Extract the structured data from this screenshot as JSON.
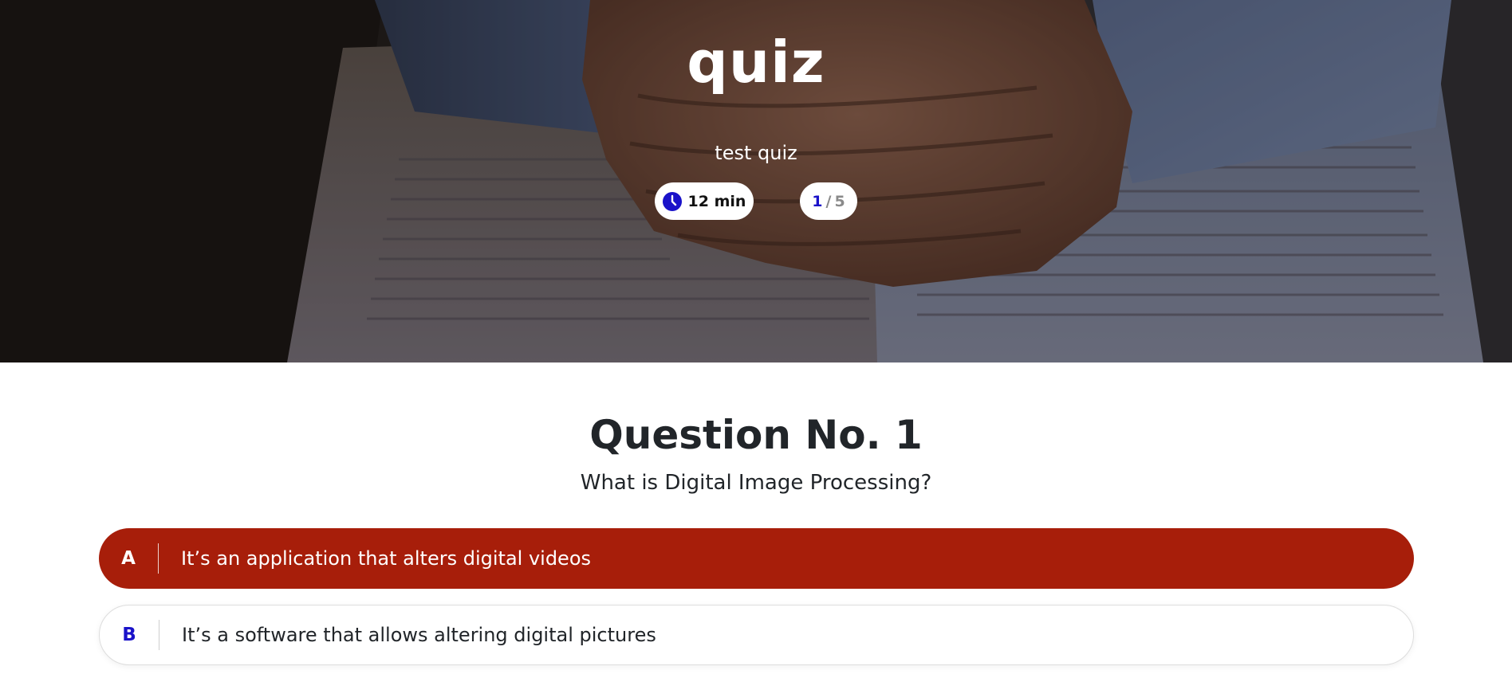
{
  "hero": {
    "title": "quiz",
    "subtitle": "test quiz",
    "timer": {
      "icon": "clock-icon",
      "label": "12 min"
    },
    "progress": {
      "current": "1",
      "separator": "/",
      "total": "5"
    }
  },
  "question": {
    "number_label": "Question No. 1",
    "text": "What is Digital Image Processing?",
    "options": [
      {
        "letter": "A",
        "text": "It’s an application that alters digital videos",
        "selected": true
      },
      {
        "letter": "B",
        "text": "It’s a software that allows altering digital pictures",
        "selected": false
      }
    ]
  },
  "colors": {
    "accent_blue": "#1a12c9",
    "selected_option": "#a71e0a"
  }
}
